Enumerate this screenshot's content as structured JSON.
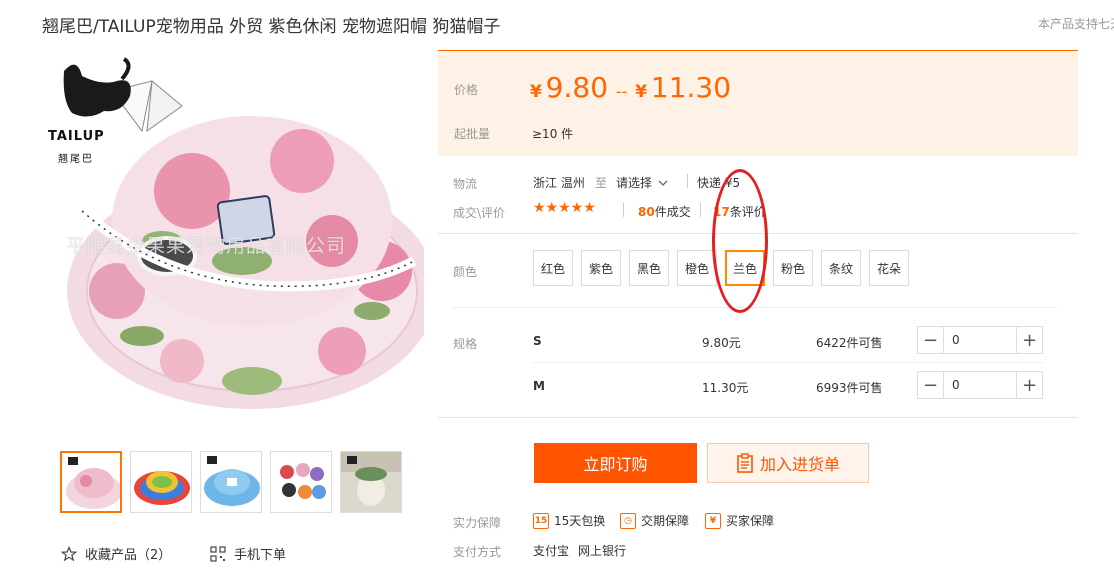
{
  "product": {
    "title": "翘尾巴/TAILUP宠物用品 外贸 紫色休闲 宠物遮阳帽 狗猫帽子",
    "side_note": "本产品支持七天"
  },
  "image": {
    "logo_text": "TAILUP",
    "logo_sub": "翘尾巴",
    "watermark": "平阳县金果果宠物用品有限公司"
  },
  "price": {
    "label": "价格",
    "currency": "¥",
    "min": "9.80",
    "separator": "--",
    "max": "11.30",
    "moq_label": "起批量",
    "moq_value": "≥10 件"
  },
  "logistics": {
    "label": "物流",
    "origin": "浙江 温州",
    "to": "至",
    "select": "请选择",
    "express": "快递 ¥5"
  },
  "deals": {
    "label": "成交\\评价",
    "stars": "★★★★★",
    "deal_count": "80",
    "deal_suffix": "件成交",
    "review_count": "17",
    "review_suffix": "条评价"
  },
  "colors": {
    "label": "颜色",
    "options": [
      "红色",
      "紫色",
      "黑色",
      "橙色",
      "兰色",
      "粉色",
      "条纹",
      "花朵"
    ],
    "selected": "兰色"
  },
  "specs": {
    "label": "规格",
    "rows": [
      {
        "name": "S",
        "price": "9.80元",
        "stock": "6422件可售",
        "qty": "0"
      },
      {
        "name": "M",
        "price": "11.30元",
        "stock": "6993件可售",
        "qty": "0"
      }
    ]
  },
  "actions": {
    "buy_now": "立即订购",
    "add_to_cart": "加入进货单"
  },
  "guarantees": {
    "label": "实力保障",
    "items": [
      "15天包换",
      "交期保障",
      "买家保障"
    ]
  },
  "payment": {
    "label": "支付方式",
    "methods": [
      "支付宝",
      "网上银行"
    ]
  },
  "footer_links": {
    "favorite": "收藏产品（2）",
    "mobile_order": "手机下单"
  },
  "colors_theme": {
    "accent": "#ff5500",
    "price": "#ff6600",
    "annotation_circle": "#e32020"
  }
}
